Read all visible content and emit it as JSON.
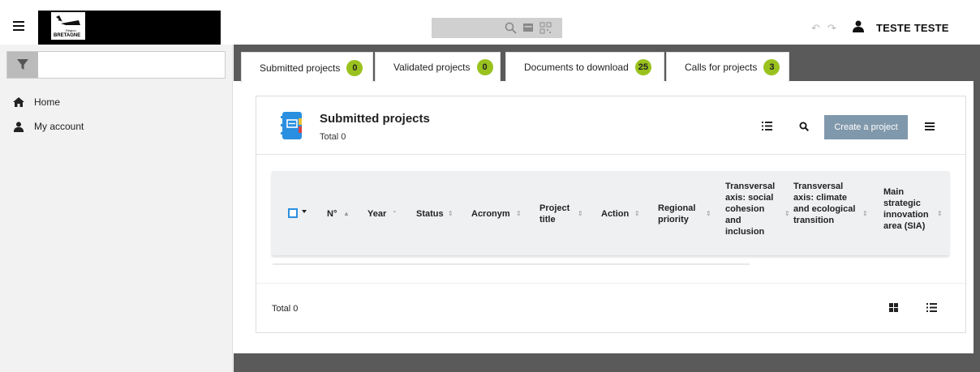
{
  "header": {
    "logo_text": "BRETAGNE",
    "logo_sub": "Région",
    "user_name": "TESTE TESTE",
    "icons": [
      "hamburger-icon",
      "search-icon",
      "card-icon",
      "qr-icon",
      "undo-icon",
      "redo-icon",
      "user-icon"
    ]
  },
  "sidebar": {
    "filter_placeholder": "",
    "items": [
      {
        "label": "Home",
        "icon": "home-icon"
      },
      {
        "label": "My account",
        "icon": "user-icon"
      }
    ]
  },
  "tabs": [
    {
      "label": "Submitted projects",
      "count": "0",
      "active": true
    },
    {
      "label": "Validated projects",
      "count": "0",
      "active": false
    },
    {
      "label": "Documents to download",
      "count": "25",
      "active": false
    },
    {
      "label": "Calls for projects",
      "count": "3",
      "active": false
    }
  ],
  "panel": {
    "title": "Submitted projects",
    "total": "Total 0",
    "create_button": "Create a project",
    "footer_total": "Total 0"
  },
  "table": {
    "columns": [
      "N°",
      "Year",
      "Status",
      "Acronym",
      "Project title",
      "Action",
      "Regional priority",
      "Transversal axis: social cohesion and inclusion",
      "Transversal axis: climate and ecological transition",
      "Main strategic innovation area (SIA)"
    ],
    "rows": []
  },
  "colors": {
    "badge": "#9ac21e",
    "create_button": "#8098ab",
    "main_bg": "#5a5a5a",
    "checkbox": "#2a8fe0"
  }
}
